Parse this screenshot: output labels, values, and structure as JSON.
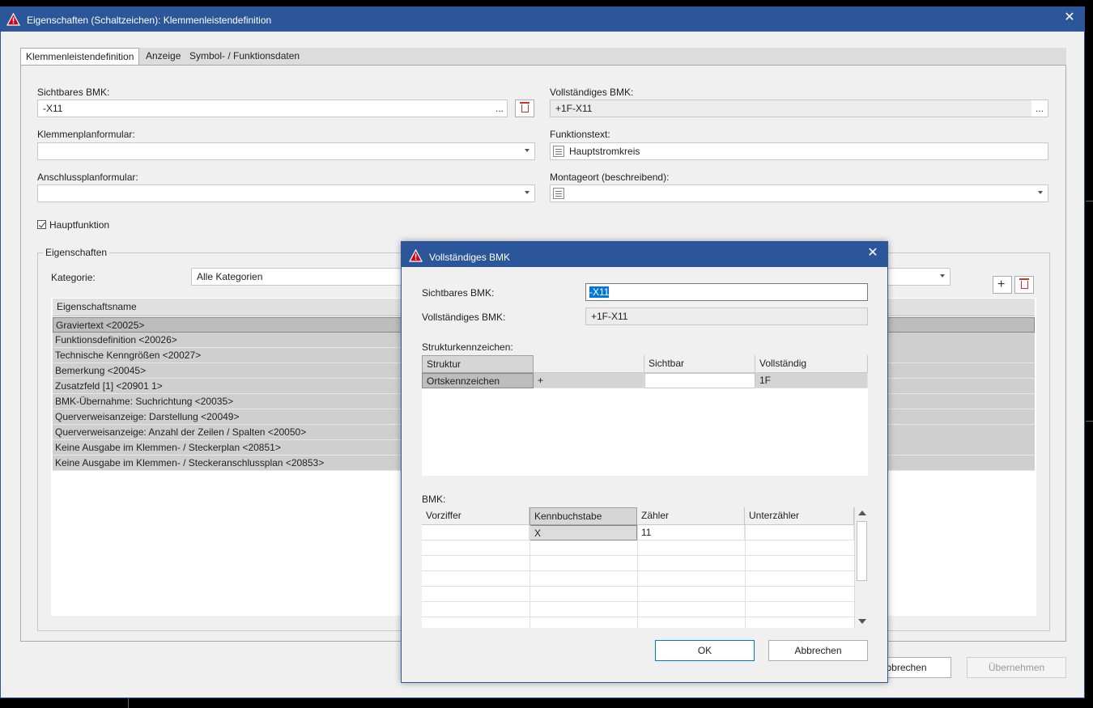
{
  "main_window": {
    "title": "Eigenschaften (Schaltzeichen): Klemmenleistendefinition",
    "tabs": [
      {
        "label": "Klemmenleistendefinition"
      },
      {
        "label": "Anzeige"
      },
      {
        "label": "Symbol- / Funktionsdaten"
      }
    ],
    "fields": {
      "sichtbares_bmk_label": "Sichtbares BMK:",
      "sichtbares_bmk_value": "-X11",
      "vollstaendiges_bmk_label": "Vollständiges BMK:",
      "vollstaendiges_bmk_value": "+1F-X11",
      "klemmenplanformular_label": "Klemmenplanformular:",
      "klemmenplanformular_value": "",
      "funktionstext_label": "Funktionstext:",
      "funktionstext_value": "Hauptstromkreis",
      "anschlussplanformular_label": "Anschlussplanformular:",
      "anschlussplanformular_value": "",
      "montageort_label": "Montageort (beschreibend):",
      "montageort_value": "",
      "hauptfunktion_label": "Hauptfunktion",
      "hauptfunktion_checked": true,
      "dots": "..."
    },
    "eigenschaften": {
      "group_title": "Eigenschaften",
      "kategorie_label": "Kategorie:",
      "kategorie_value": "Alle Kategorien",
      "column_header": "Eigenschaftsname",
      "rows": [
        "Graviertext <20025>",
        "Funktionsdefinition <20026>",
        "Technische Kenngrößen <20027>",
        "Bemerkung <20045>",
        "Zusatzfeld [1] <20901 1>",
        "BMK-Übernahme: Suchrichtung <20035>",
        "Querverweisanzeige: Darstellung <20049>",
        "Querverweisanzeige: Anzahl der Zeilen / Spalten <20050>",
        "Keine Ausgabe im Klemmen- / Steckerplan <20851>",
        "Keine Ausgabe im Klemmen- / Steckeranschlussplan <20853>"
      ]
    },
    "buttons": {
      "abbrechen": "Abbrechen",
      "uebernehmen": "Übernehmen"
    }
  },
  "dialog": {
    "title": "Vollständiges BMK",
    "sichtbares_bmk_label": "Sichtbares BMK:",
    "sichtbares_bmk_value": "-X11",
    "vollstaendiges_bmk_label": "Vollständiges BMK:",
    "vollstaendiges_bmk_value": "+1F-X11",
    "struktur_label": "Strukturkennzeichen:",
    "struktur_headers": [
      "Struktur",
      "",
      "Sichtbar",
      "Vollständig"
    ],
    "struktur_row": {
      "struktur": "Ortskennzeichen",
      "prefix": "+",
      "sichtbar": "",
      "vollstaendig": "1F"
    },
    "bmk_label": "BMK:",
    "bmk_headers": [
      "Vorziffer",
      "Kennbuchstabe",
      "Zähler",
      "Unterzähler"
    ],
    "bmk_row": {
      "vorziffer": "",
      "kennbuchstabe": "X",
      "zaehler": "11",
      "unterzaehler": ""
    },
    "ok": "OK",
    "abbrechen": "Abbrechen"
  },
  "colors": {
    "titlebar": "#2b579a",
    "accent_selection": "#0078d7",
    "warning_icon": "#d0021b"
  }
}
